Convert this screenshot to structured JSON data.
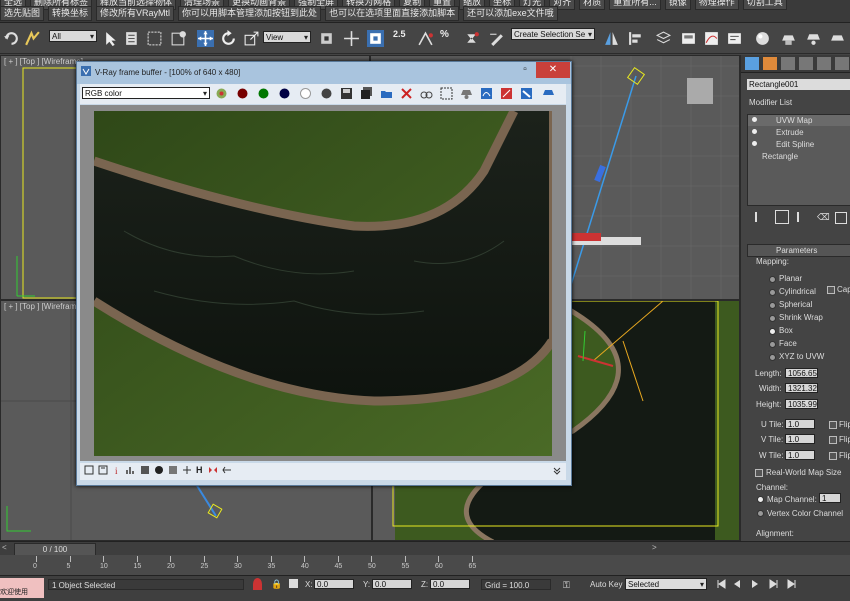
{
  "top_menu": {
    "row1": [
      "全选",
      "删除所有标签",
      "释放当前选择物体",
      "清理场景",
      "更换动画背景",
      "强制全屏",
      "转换为网格",
      "复制",
      "重置",
      "缩放",
      "坐标",
      "灯光",
      "对齐",
      "材质",
      "重置所有...",
      "镜像",
      "物理操作",
      "切割工具"
    ],
    "row2": [
      "选先贴图",
      "转换坐标",
      "修改所有VRayMtl",
      "你可以用脚本管理添加按钮到此处",
      "也可以在选项里面直接添加脚本",
      "还可以添加exe文件哦"
    ]
  },
  "toolbar": {
    "selection_filter": "All",
    "ref_coord": "View",
    "named_selection": "Create Selection Se",
    "snap_label": "2.5",
    "percent_snap_label": "%"
  },
  "viewports": {
    "top_left_label": "[ + ] [Top ] [Wireframe]",
    "bottom_left_label": "[ + ] [Top ] [Wireframe]"
  },
  "vray": {
    "title": "V-Ray frame buffer - [100% of 640 x 480]",
    "channel": "RGB color"
  },
  "command_panel": {
    "object_name": "Rectangle001",
    "modifier_list": "Modifier List",
    "stack": [
      "UVW Map",
      "Extrude",
      "Edit Spline",
      "Rectangle"
    ],
    "rollout": "Parameters",
    "mapping_label": "Mapping:",
    "mapping_options": [
      "Planar",
      "Cylindrical",
      "Spherical",
      "Shrink Wrap",
      "Box",
      "Face",
      "XYZ to UVW"
    ],
    "mapping_selected": "Box",
    "cap_label": "Cap",
    "length_label": "Length:",
    "length": "1056.65",
    "width_label": "Width:",
    "width": "1321.32",
    "height_label": "Height:",
    "height": "1035.99",
    "u_tile_label": "U Tile:",
    "u_tile": "1.0",
    "v_tile_label": "V Tile:",
    "v_tile": "1.0",
    "w_tile_label": "W Tile:",
    "w_tile": "1.0",
    "flip_label": "Flip",
    "real_world": "Real-World Map Size",
    "channel_label": "Channel:",
    "map_channel": "Map Channel:",
    "map_channel_value": "1",
    "vertex_color_channel": "Vertex Color Channel",
    "alignment_label": "Alignment:"
  },
  "timeline": {
    "frame": "0 / 100",
    "ticks": [
      "0",
      "5",
      "10",
      "15",
      "20",
      "25",
      "30",
      "35",
      "40",
      "45",
      "50",
      "55",
      "60",
      "65"
    ]
  },
  "status": {
    "left": "1 Object Selected",
    "x_label": "X:",
    "x": "0.0",
    "y_label": "Y:",
    "y": "0.0",
    "z_label": "Z:",
    "z": "0.0",
    "grid": "Grid = 100.0",
    "autokey": "Auto Key",
    "selected": "Selected",
    "maxscript": "欢迎使用 MAXSc"
  },
  "colors": {
    "vray_title": "#a9c4de",
    "close_button": "#c9403a",
    "grass": "#3d5a1f",
    "water": "#141a14"
  }
}
